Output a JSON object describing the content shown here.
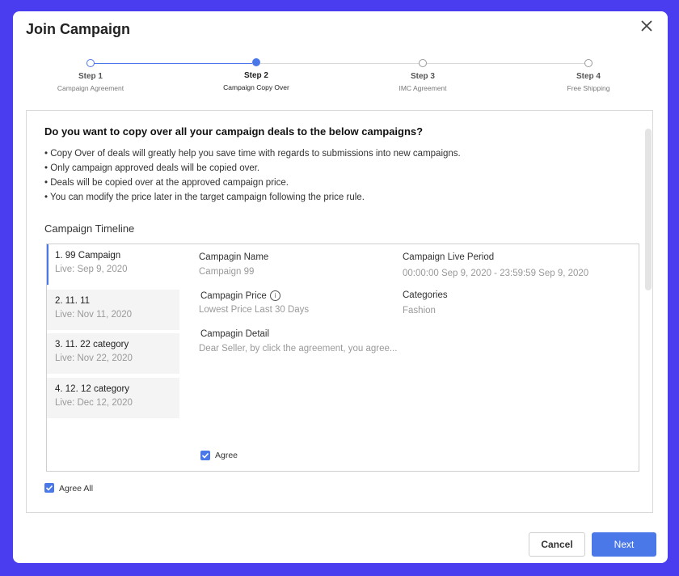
{
  "modal": {
    "title": "Join Campaign"
  },
  "colors": {
    "accent": "#4a78e8",
    "backdrop": "#4a3df0"
  },
  "steps": [
    {
      "label": "Step 1",
      "sub": "Campaign Agreement"
    },
    {
      "label": "Step 2",
      "sub": "Campaign Copy Over"
    },
    {
      "label": "Step 3",
      "sub": "IMC Agreement"
    },
    {
      "label": "Step 4",
      "sub": "Free Shipping"
    }
  ],
  "content": {
    "question": "Do you want to copy over all your campaign deals to the below campaigns?",
    "bullets": [
      "• Copy Over of deals will greatly help you save time with regards to submissions into new campaigns.",
      "• Only campaign approved deals will be copied over.",
      "• Deals will be copied over at the approved campaign price.",
      "• You can modify the price later in the target campaign following the price rule."
    ],
    "timeline_title": "Campaign Timeline"
  },
  "campaigns": [
    {
      "name": "1. 99 Campaign",
      "date": "Live: Sep 9, 2020"
    },
    {
      "name": "2. 11. 11",
      "date": "Live: Nov 11, 2020"
    },
    {
      "name": "3. 11. 22 category",
      "date": "Live: Nov 22, 2020"
    },
    {
      "name": "4. 12. 12 category",
      "date": "Live: Dec 12, 2020"
    }
  ],
  "detail": {
    "name_label": "Campagin Name",
    "name_value": "Campaign 99",
    "period_label": "Campaign Live Period",
    "period_value": "00:00:00 Sep 9, 2020 - 23:59:59 Sep 9, 2020",
    "price_label": "Campagin Price",
    "price_value": "Lowest Price Last 30 Days",
    "categories_label": "Categories",
    "categories_value": "Fashion",
    "detail_label": "Campagin Detail",
    "detail_value": "Dear Seller, by click the agreement, you agree...",
    "agree_label": "Agree"
  },
  "agree_all_label": "Agree All",
  "buttons": {
    "cancel": "Cancel",
    "next": "Next"
  }
}
